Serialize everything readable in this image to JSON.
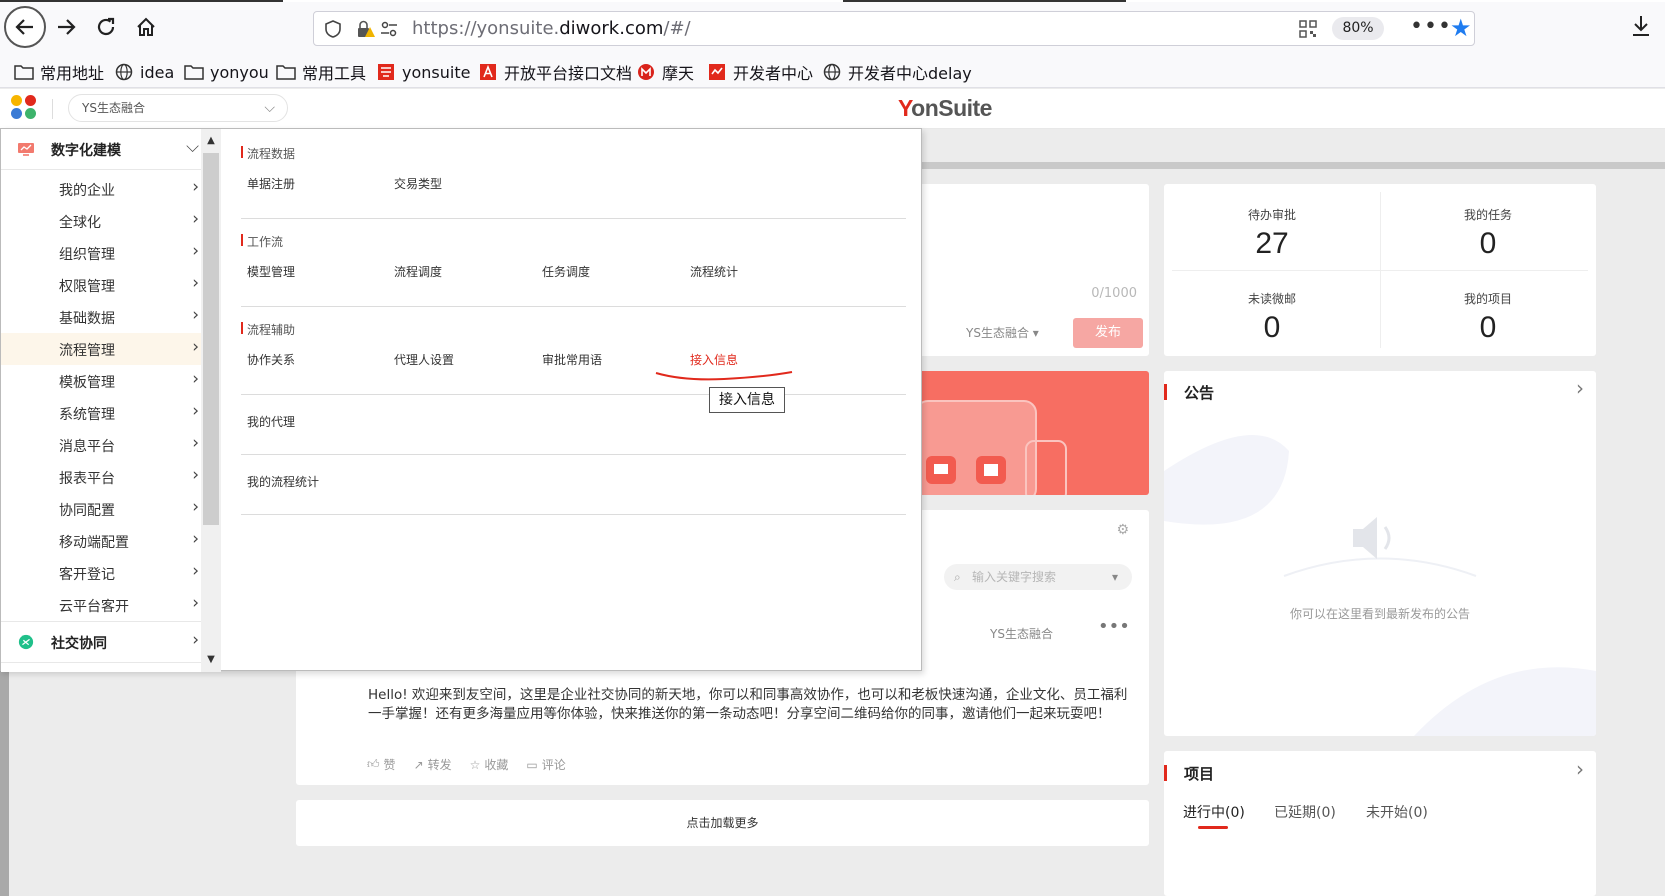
{
  "browser": {
    "url_prefix": "https://yonsuite.",
    "url_domain": "diwork.com",
    "url_suffix": "/#/",
    "zoom": "80%",
    "bookmarks": [
      {
        "label": "常用地址",
        "icon": "folder-icon"
      },
      {
        "label": "idea",
        "icon": "globe-icon"
      },
      {
        "label": "yonyou",
        "icon": "folder-icon"
      },
      {
        "label": "常用工具",
        "icon": "folder-icon"
      },
      {
        "label": "yonsuite",
        "icon": "yonsuite-icon"
      },
      {
        "label": "开放平台接口文档",
        "icon": "doc-icon"
      },
      {
        "label": "摩天",
        "icon": "motian-icon"
      },
      {
        "label": "开发者中心",
        "icon": "dev-icon"
      },
      {
        "label": "开发者中心delay",
        "icon": "globe-icon"
      }
    ]
  },
  "header": {
    "org_select": "YS生态融合",
    "brand_y": "Y",
    "brand_rest": "onSuite"
  },
  "menu": {
    "group_modeling": "数字化建模",
    "group_social": "社交协同",
    "items": [
      {
        "label": "我的企业"
      },
      {
        "label": "全球化"
      },
      {
        "label": "组织管理"
      },
      {
        "label": "权限管理"
      },
      {
        "label": "基础数据"
      },
      {
        "label": "流程管理"
      },
      {
        "label": "模板管理"
      },
      {
        "label": "系统管理"
      },
      {
        "label": "消息平台"
      },
      {
        "label": "报表平台"
      },
      {
        "label": "协同配置"
      },
      {
        "label": "移动端配置"
      },
      {
        "label": "客开登记"
      },
      {
        "label": "云平台客开"
      }
    ],
    "sections": {
      "flow_data": "流程数据",
      "workflow": "工作流",
      "flow_assist": "流程辅助"
    },
    "links": {
      "doc_register": "单据注册",
      "trade_type": "交易类型",
      "model_mgmt": "模型管理",
      "flow_schedule": "流程调度",
      "task_schedule": "任务调度",
      "flow_stats": "流程统计",
      "collab_relation": "协作关系",
      "agent_setting": "代理人设置",
      "approval_phrases": "审批常用语",
      "access_info": "接入信息",
      "my_agent": "我的代理",
      "my_flow_stats": "我的流程统计"
    },
    "tooltip": "接入信息"
  },
  "dashboard": {
    "post_counter": "0/1000",
    "org_tag": "YS生态融合",
    "publish": "发布",
    "stats": [
      {
        "label": "待办审批",
        "value": "27"
      },
      {
        "label": "我的任务",
        "value": "0"
      },
      {
        "label": "未读微邮",
        "value": "0"
      },
      {
        "label": "我的项目",
        "value": "0"
      }
    ],
    "notice_title": "公告",
    "notice_empty": "你可以在这里看到最新发布的公告",
    "search_placeholder": "输入关键字搜索",
    "feed_org": "YS生态融合",
    "feed_text": "Hello! 欢迎来到友空间，这里是企业社交协同的新天地，你可以和同事高效协作，也可以和老板快速沟通，企业文化、员工福利一手掌握！还有更多海量应用等你体验，快来推送你的第一条动态吧！分享空间二维码给你的同事，邀请他们一起来玩耍吧！",
    "actions": {
      "like": "赞",
      "forward": "转发",
      "favorite": "收藏",
      "comment": "评论"
    },
    "load_more": "点击加载更多",
    "project_title": "项目",
    "project_tabs": [
      "进行中(0)",
      "已延期(0)",
      "未开始(0)"
    ]
  }
}
